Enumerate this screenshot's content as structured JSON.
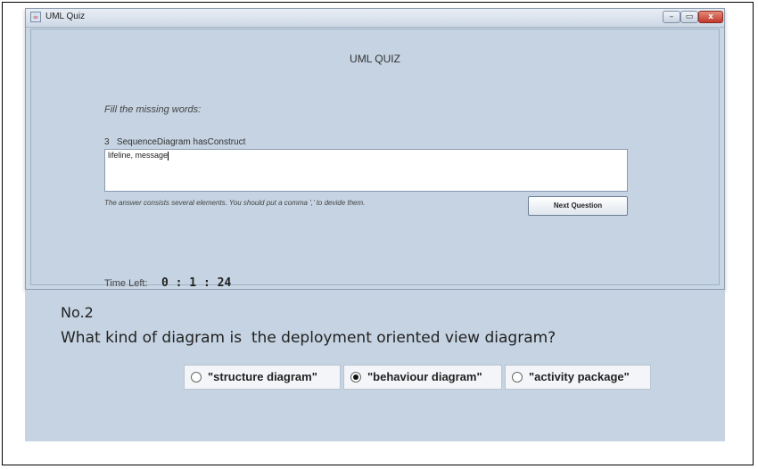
{
  "window": {
    "title": "UML Quiz",
    "icon": "java-app-icon",
    "controls": {
      "minimize": "–",
      "maximize": "▭",
      "close": "x"
    }
  },
  "quiz": {
    "header": "UML QUIZ",
    "instruction": "Fill the missing words:",
    "question_line": "3   SequenceDiagram hasConstruct",
    "answer_value": "lifeline, message",
    "hint": "The answer consists several elements. You should put a comma ',' to devide them.",
    "next_label": "Next Question",
    "time_label": "Time Left:",
    "time_value": "0 : 1 : 24"
  },
  "bottom": {
    "number": "No.2",
    "question": "What kind of diagram is  the deployment oriented view diagram?",
    "options": [
      {
        "label": "\"structure diagram\"",
        "selected": false
      },
      {
        "label": "\"behaviour diagram\"",
        "selected": true
      },
      {
        "label": "\"activity package\"",
        "selected": false
      }
    ]
  }
}
